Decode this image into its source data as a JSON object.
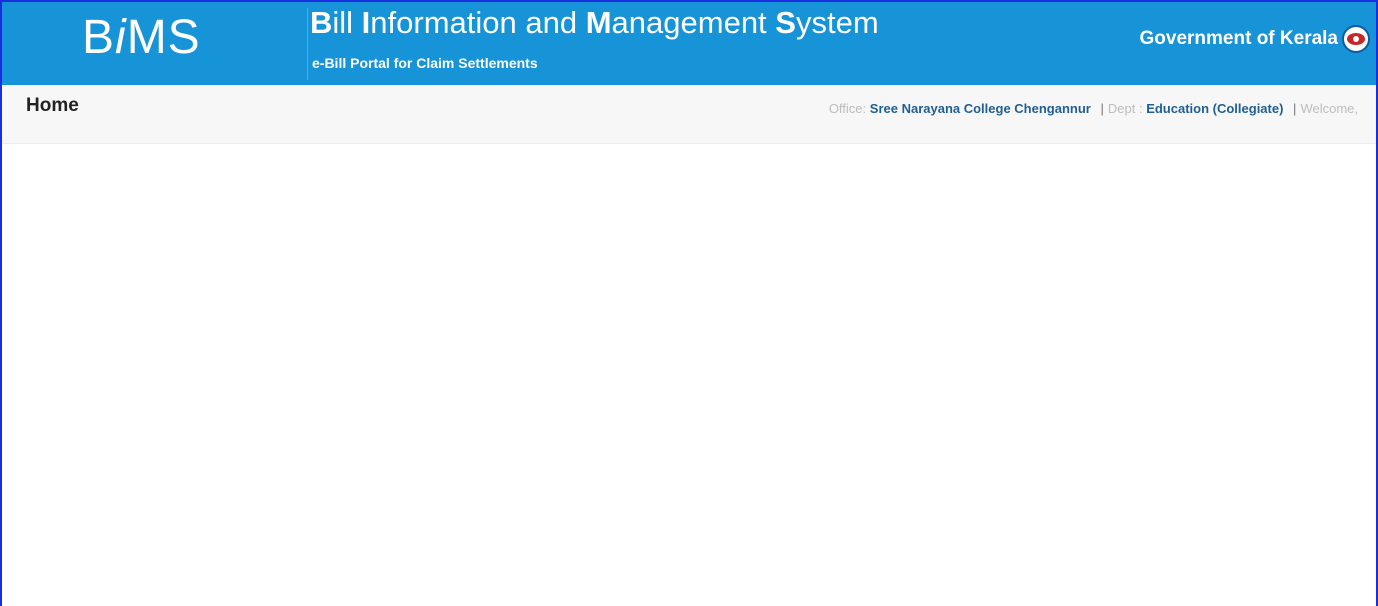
{
  "header": {
    "logo": {
      "b": "B",
      "i": "i",
      "ms": "MS"
    },
    "title": {
      "b1": "B",
      "r1": "ill ",
      "b2": "I",
      "r2": "nformation and ",
      "b3": "M",
      "r3": "anagement ",
      "b4": "S",
      "r4": "ystem"
    },
    "subtitle": "e-Bill Portal for Claim Settlements",
    "government": "Government of Kerala",
    "emblem_icon": "kerala-emblem-icon",
    "bg_color": "#1793d8"
  },
  "subbar": {
    "page_title": "Home",
    "office_label": "Office:",
    "office_value": "Sree Narayana College Chengannur",
    "dept_label": "Dept :",
    "dept_value": "Education (Collegiate)",
    "separator": "|",
    "welcome": "Welcome,"
  }
}
